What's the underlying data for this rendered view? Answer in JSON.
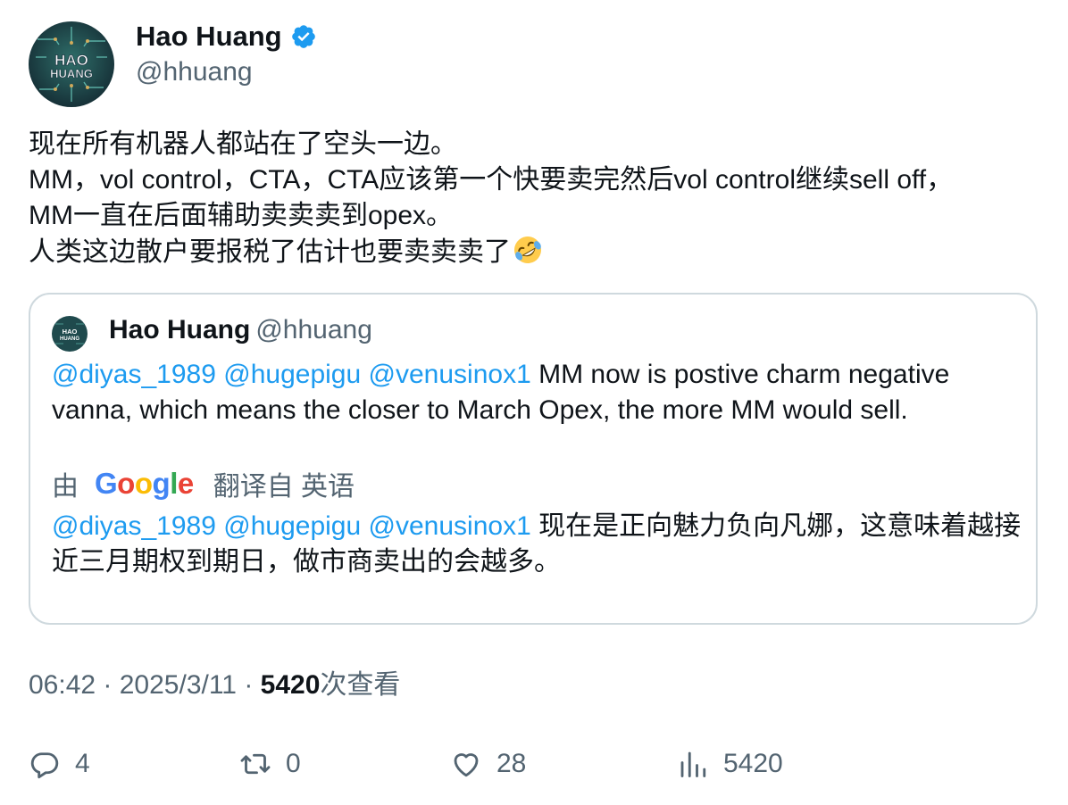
{
  "author": {
    "name": "Hao Huang",
    "handle": "@hhuang",
    "avatar_text": [
      "HAO",
      "HUANG"
    ]
  },
  "tweet": {
    "lines": [
      "现在所有机器人都站在了空头一边。",
      "MM，vol control，CTA，CTA应该第一个快要卖完然后vol control继续sell off，",
      "MM一直在后面辅助卖卖卖到opex。",
      "人类这边散户要报税了估计也要卖卖卖了"
    ],
    "emoji": "rolling-on-the-floor-laughing"
  },
  "quote": {
    "author_name": "Hao Huang",
    "author_handle": "@hhuang",
    "mentions": [
      "@diyas_1989",
      "@hugepigu",
      "@venusinox1"
    ],
    "text": "MM now is postive charm negative vanna, which means the closer to March Opex, the more MM would sell.",
    "translation_by": "由",
    "translation_provider": "Google",
    "translation_from": "翻译自 英语",
    "translated_text": "现在是正向魅力负向凡娜，这意味着越接近三月期权到期日，做市商卖出的会越多。"
  },
  "meta": {
    "time": "06:42",
    "separator": " · ",
    "date": "2025/3/11",
    "views": "5420",
    "views_label": "次查看"
  },
  "actions": {
    "replies": "4",
    "retweets": "0",
    "likes": "28",
    "views": "5420"
  },
  "colors": {
    "text": "#0f1419",
    "secondary": "#536471",
    "link": "#1d9bf0",
    "border": "#cfd9de",
    "verified": "#1d9bf0"
  }
}
